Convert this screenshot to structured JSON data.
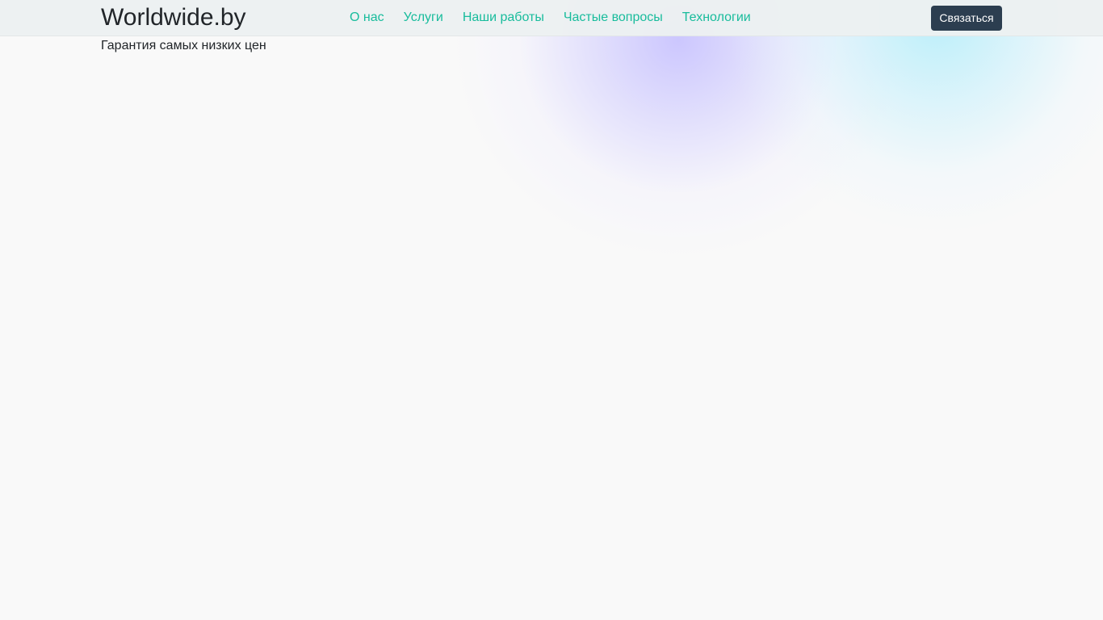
{
  "header": {
    "brand": "Worldwide.by",
    "nav": [
      {
        "label": "О нас"
      },
      {
        "label": "Услуги"
      },
      {
        "label": "Наши работы"
      },
      {
        "label": "Частые вопросы"
      },
      {
        "label": "Технологии"
      }
    ],
    "contact_label": "Связаться"
  },
  "hero": {
    "tagline": "Гарантия самых низких цен"
  },
  "colors": {
    "accent": "#18bc9c",
    "button_bg": "#2c3e50",
    "navbar_bg": "#ecf0f1",
    "page_bg": "#f9f9f9"
  }
}
